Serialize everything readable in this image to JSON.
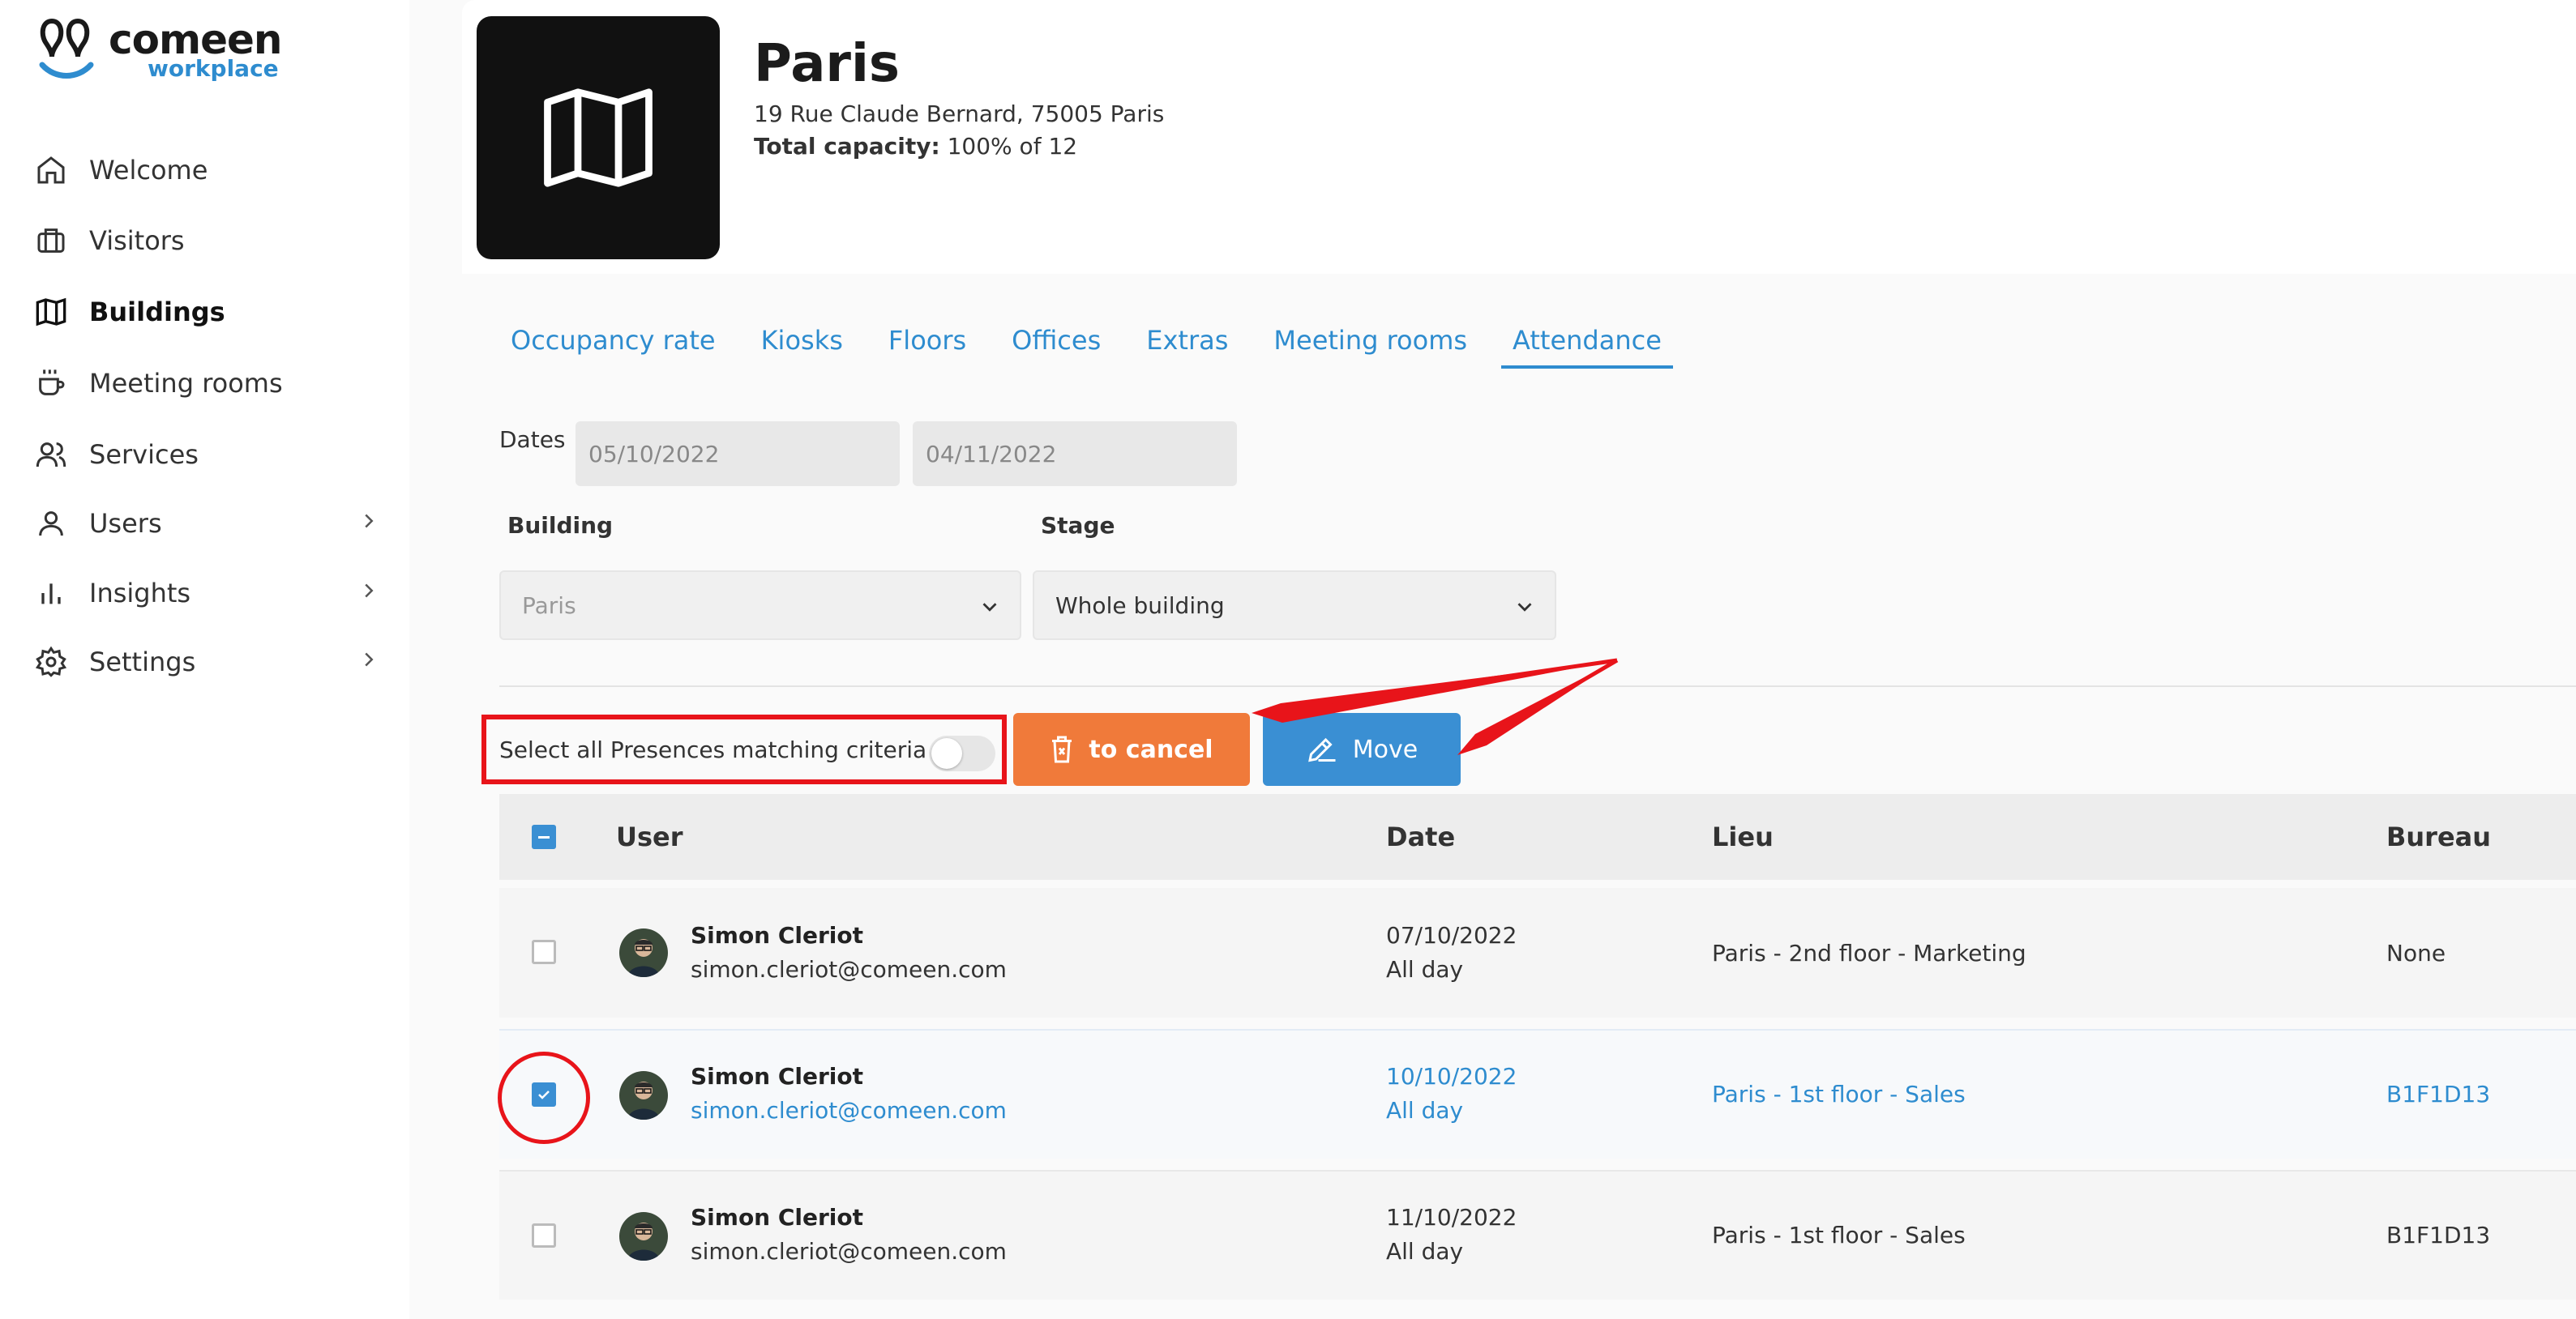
{
  "brand": {
    "name": "comeen",
    "sub": "workplace"
  },
  "sidebar": {
    "items": [
      {
        "label": "Welcome",
        "icon": "home-icon",
        "active": false
      },
      {
        "label": "Visitors",
        "icon": "briefcase-icon",
        "active": false
      },
      {
        "label": "Buildings",
        "icon": "map-icon",
        "active": true
      },
      {
        "label": "Meeting rooms",
        "icon": "coffee-cup-icon",
        "active": false
      },
      {
        "label": "Services",
        "icon": "people-icon",
        "active": false
      },
      {
        "label": "Users",
        "icon": "user-icon",
        "active": false,
        "expandable": true
      },
      {
        "label": "Insights",
        "icon": "bar-chart-icon",
        "active": false,
        "expandable": true
      },
      {
        "label": "Settings",
        "icon": "gear-icon",
        "active": false,
        "expandable": true
      }
    ]
  },
  "building": {
    "title": "Paris",
    "address": "19 Rue Claude Bernard, 75005 Paris",
    "capacity_label": "Total capacity:",
    "capacity_value": "100% of 12"
  },
  "tabs": [
    {
      "label": "Occupancy rate",
      "active": false
    },
    {
      "label": "Kiosks",
      "active": false
    },
    {
      "label": "Floors",
      "active": false
    },
    {
      "label": "Offices",
      "active": false
    },
    {
      "label": "Extras",
      "active": false
    },
    {
      "label": "Meeting rooms",
      "active": false
    },
    {
      "label": "Attendance",
      "active": true
    }
  ],
  "filters": {
    "dates_label": "Dates",
    "date_from": "05/10/2022",
    "date_to": "04/11/2022",
    "building_label": "Building",
    "building_value": "Paris",
    "stage_label": "Stage",
    "stage_value": "Whole building"
  },
  "actions": {
    "select_all_label": "Select all Presences matching criteria",
    "cancel_label": "to cancel",
    "move_label": "Move"
  },
  "table": {
    "headers": {
      "user": "User",
      "date": "Date",
      "place": "Lieu",
      "desk": "Bureau"
    },
    "rows": [
      {
        "name": "Simon Cleriot",
        "email": "simon.cleriot@comeen.com",
        "date": "07/10/2022",
        "period": "All day",
        "place": "Paris - 2nd floor - Marketing",
        "desk": "None",
        "selected": false
      },
      {
        "name": "Simon Cleriot",
        "email": "simon.cleriot@comeen.com",
        "date": "10/10/2022",
        "period": "All day",
        "place": "Paris - 1st floor - Sales",
        "desk": "B1F1D13",
        "selected": true
      },
      {
        "name": "Simon Cleriot",
        "email": "simon.cleriot@comeen.com",
        "date": "11/10/2022",
        "period": "All day",
        "place": "Paris - 1st floor - Sales",
        "desk": "B1F1D13",
        "selected": false
      }
    ]
  },
  "colors": {
    "accent": "#2e8ccf",
    "cancel": "#f07a3a",
    "move": "#3a8fd3",
    "annotation": "#e8141a"
  }
}
